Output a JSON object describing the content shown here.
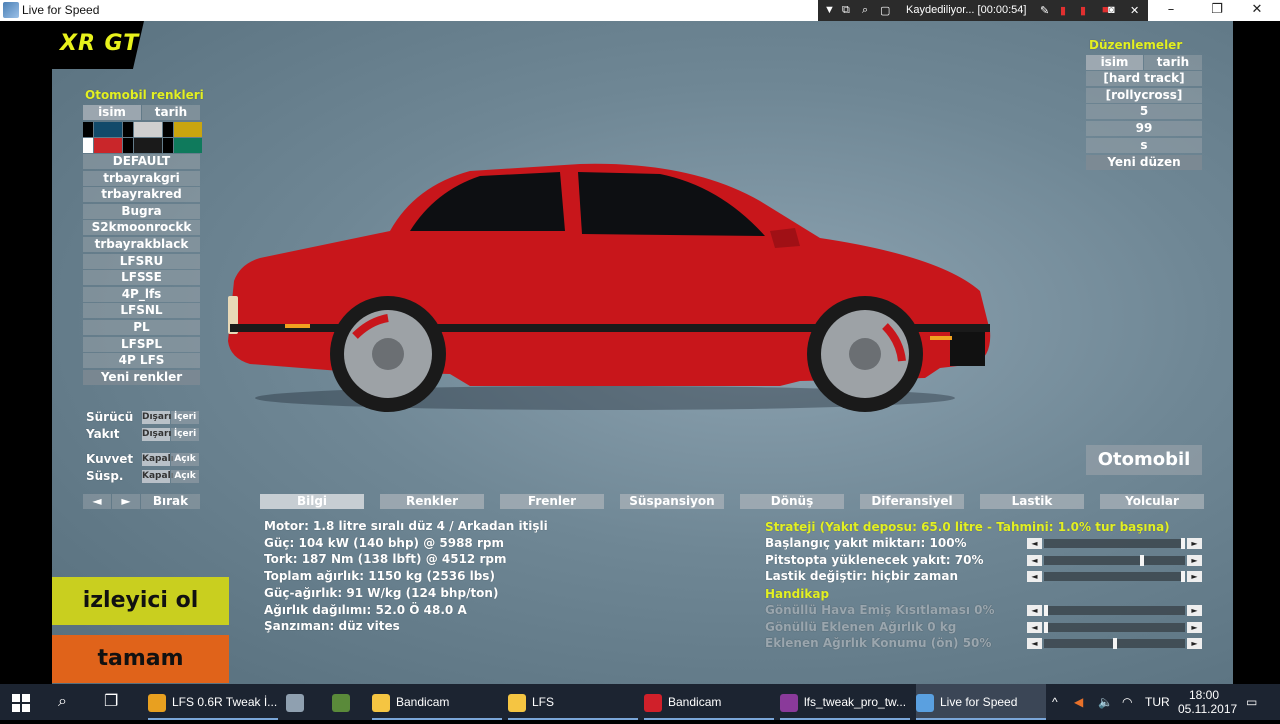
{
  "window": {
    "title": "Live for Speed",
    "minimize": "–",
    "maximize": "❐",
    "close": "✕"
  },
  "recorder": {
    "status": "Kaydediliyor... [00:00:54]"
  },
  "game": {
    "car_name": "XR GT",
    "colors_panel": {
      "title": "Otomobil renkleri",
      "tab_name": "isim",
      "tab_date": "tarih",
      "swatch_colors": [
        "#000000",
        "#124a6a",
        "#000000",
        "#cfcfcf",
        "#000000",
        "#c9a50f",
        "#ffffff",
        "#c9262a",
        "#000000",
        "#1a1a1a",
        "#000000",
        "#0f7a5c"
      ],
      "items": [
        "DEFAULT",
        "trbayrakgri",
        "trbayrakred",
        "Bugra",
        "S2kmoonrockk",
        "trbayrakblack",
        "LFSRU",
        "LFSSE",
        "4P_lfs",
        "LFSNL",
        "PL",
        "LFSPL",
        "4P LFS"
      ],
      "new_button": "Yeni renkler"
    },
    "options": [
      {
        "label": "Sürücü",
        "a": "Dışarı",
        "b": "İçeri"
      },
      {
        "label": "Yakıt",
        "a": "Dışarı",
        "b": "İçeri"
      },
      {
        "label": "Kuvvet",
        "a": "Kapalı",
        "b": "Açık"
      },
      {
        "label": "Süsp.",
        "a": "Kapalı",
        "b": "Açık"
      }
    ],
    "nav": {
      "prev": "◄",
      "next": "►",
      "drop": "Bırak"
    },
    "setups_panel": {
      "title": "Düzenlemeler",
      "tab_name": "isim",
      "tab_date": "tarih",
      "items": [
        "[hard track]",
        "[rollycross]",
        "5",
        "99",
        "s"
      ],
      "new_button": "Yeni düzen"
    },
    "car_button": "Otomobil",
    "tabs": [
      "Bilgi",
      "Renkler",
      "Frenler",
      "Süspansiyon",
      "Dönüş",
      "Diferansiyel",
      "Lastik",
      "Yolcular"
    ],
    "info": [
      "Motor: 1.8 litre   sıralı düz  4 / Arkadan itişli",
      "Güç: 104 kW (140 bhp) @ 5988 rpm",
      "Tork: 187 Nm (138 lbft) @ 4512 rpm",
      "Toplam ağırlık: 1150 kg (2536 lbs)",
      "Güç-ağırlık: 91 W/kg (124 bhp/ton)",
      "Ağırlık dağılımı: 52.0 Ö  48.0 A",
      "Şanzıman: düz vites"
    ],
    "strategy": {
      "title": "Strateji (Yakıt deposu: 65.0 litre - Tahmini: 1.0% tur başına)",
      "rows": [
        {
          "label": "Başlangıç yakıt miktarı: 100%",
          "value": 1.0
        },
        {
          "label": "Pitstopta yüklenecek yakıt: 70%",
          "value": 0.7
        },
        {
          "label": "Lastik değiştir: hiçbir zaman",
          "value": 1.0
        }
      ],
      "handicap_title": "Handikap",
      "handicap_rows": [
        {
          "label": "Gönüllü Hava Emiş Kısıtlaması 0%",
          "value": 0.0
        },
        {
          "label": "Gönüllü Eklenen Ağırlık 0 kg",
          "value": 0.0
        },
        {
          "label": "Eklenen Ağırlık Konumu (ön) 50%",
          "value": 0.5
        }
      ]
    },
    "spectate_button": "izleyici ol",
    "ok_button": "tamam"
  },
  "taskbar": {
    "items": [
      "LFS 0.6R Tweak İ...",
      "Bandicam",
      "LFS",
      "Bandicam",
      "lfs_tweak_pro_tw...",
      "Live for Speed"
    ],
    "language": "TUR",
    "time": "18:00",
    "date": "05.11.2017"
  }
}
